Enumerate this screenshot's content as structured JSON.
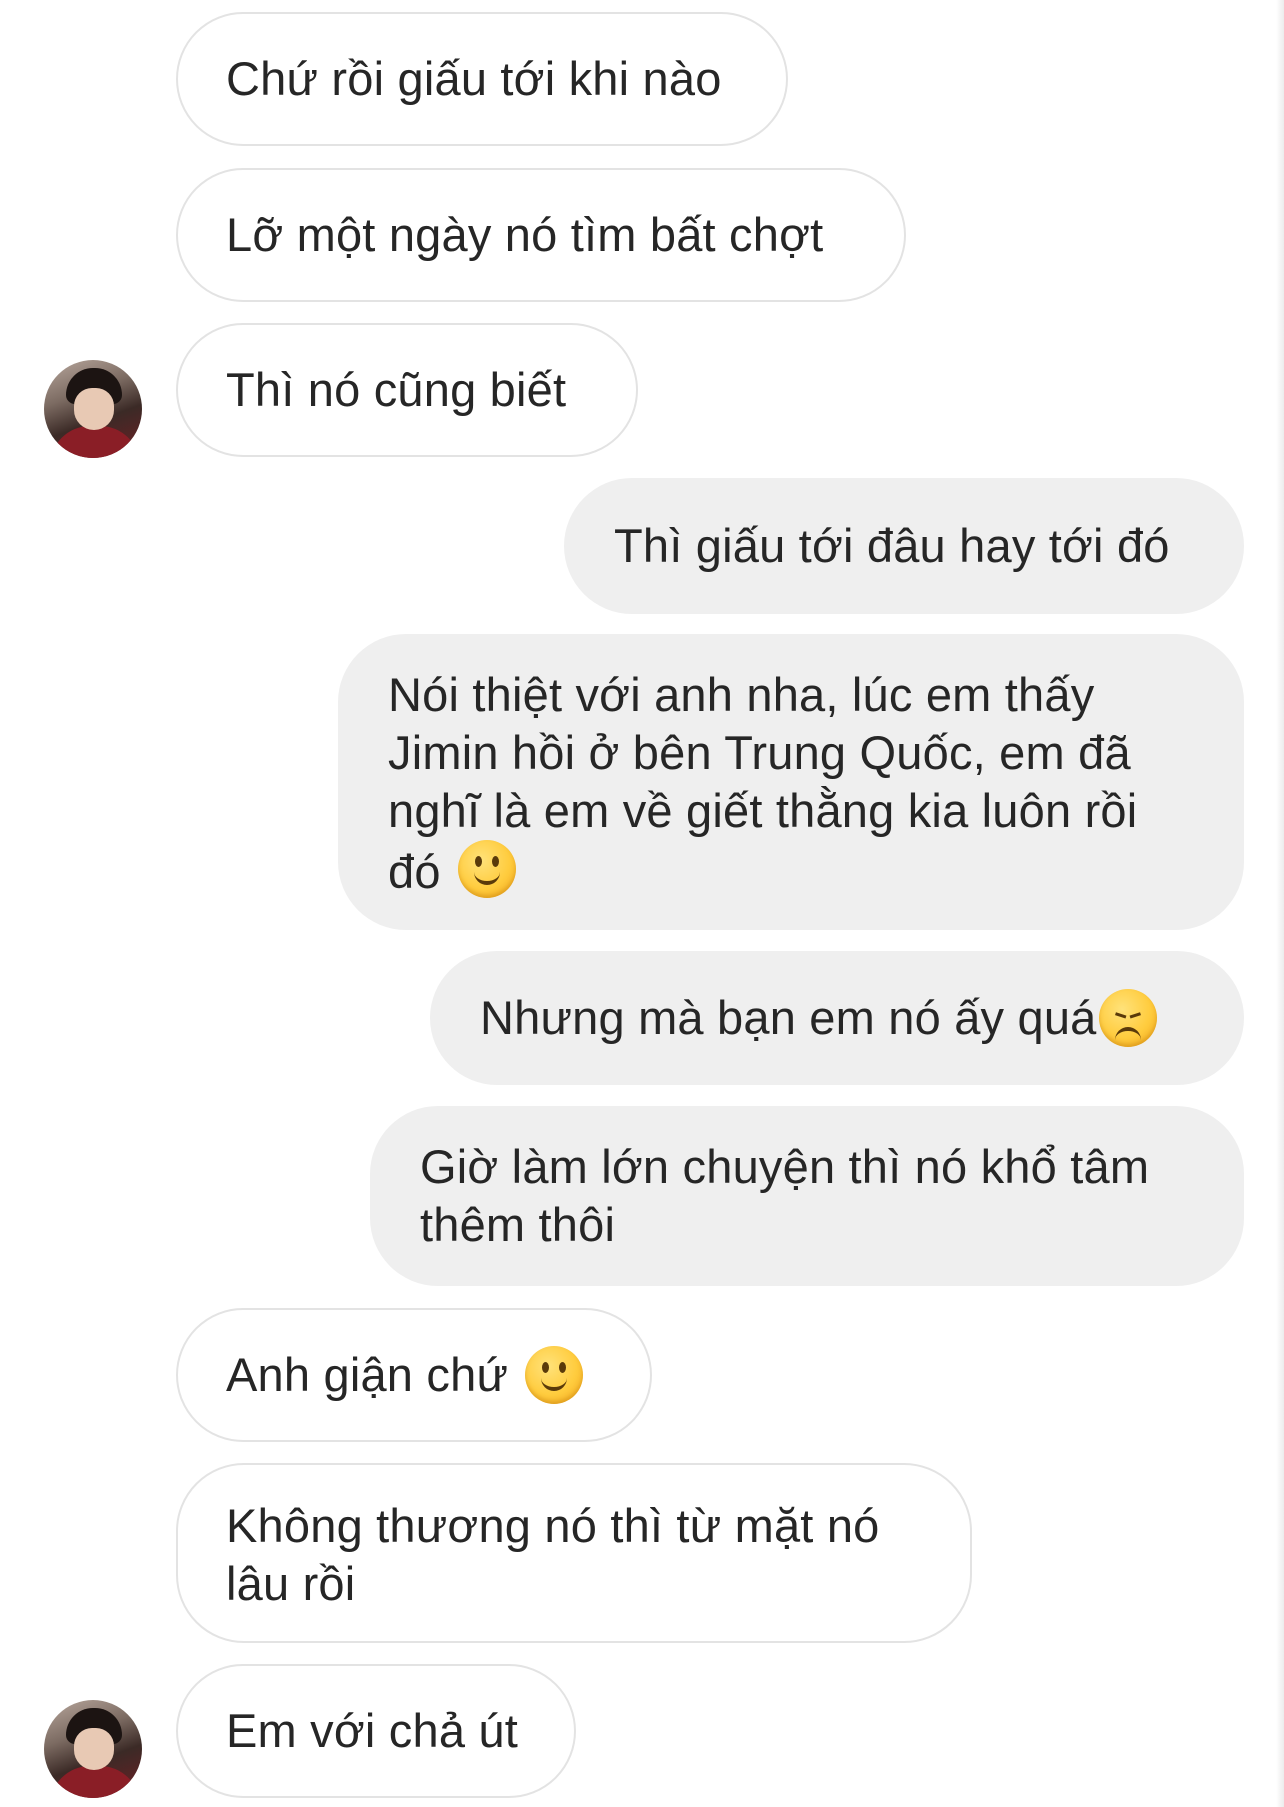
{
  "messages": [
    {
      "direction": "incoming",
      "lines": [
        "Chứ rồi giấu tới khi nào"
      ]
    },
    {
      "direction": "incoming",
      "lines": [
        "Lỡ một ngày nó tìm bất chợt"
      ]
    },
    {
      "direction": "incoming",
      "lines": [
        "Thì nó cũng biết"
      ],
      "avatar": true
    },
    {
      "direction": "outgoing",
      "lines": [
        "Thì giấu tới đâu hay tới đó"
      ]
    },
    {
      "direction": "outgoing",
      "lines": [
        "Nói thiệt với anh nha, lúc em thấy",
        "Jimin hồi ở bên Trung Quốc, em đã",
        "nghĩ là em về giết thằng kia luôn rồi",
        "đó"
      ],
      "emoji": "slightly-smiling-face"
    },
    {
      "direction": "outgoing",
      "lines": [
        "Nhưng mà bạn em nó ấy quá"
      ],
      "emoji": "disappointed-face"
    },
    {
      "direction": "outgoing",
      "lines": [
        "Giờ làm lớn chuyện thì nó khổ tâm",
        "thêm thôi"
      ]
    },
    {
      "direction": "incoming",
      "lines": [
        "Anh giận chứ"
      ],
      "emoji": "slightly-smiling-face"
    },
    {
      "direction": "incoming",
      "lines": [
        "Không thương nó thì từ mặt nó",
        "lâu rồi"
      ]
    },
    {
      "direction": "incoming",
      "lines": [
        "Em với chả út"
      ],
      "avatar": true
    }
  ],
  "avatar_icon": "profile-photo-avatar",
  "colors": {
    "incoming_bg": "#ffffff",
    "incoming_border": "#e3e3e3",
    "outgoing_bg": "#efefef",
    "text": "#262626"
  }
}
